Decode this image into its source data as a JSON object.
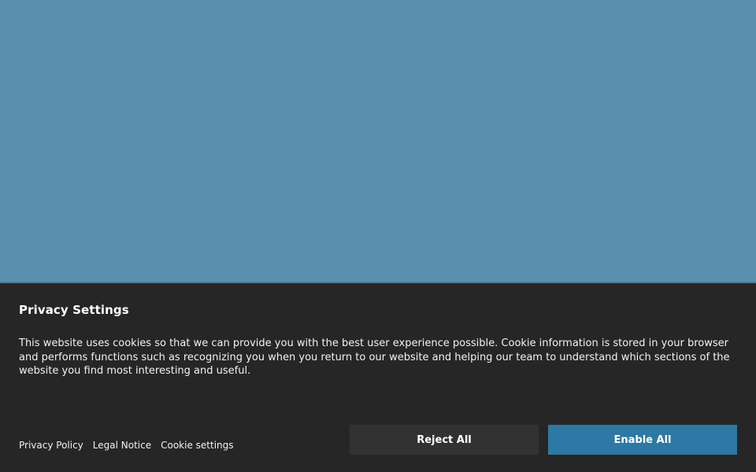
{
  "banner": {
    "title": "Privacy Settings",
    "body": "This website uses cookies so that we can provide you with the best user experience possible.  Cookie information is stored in your browser and performs functions such as recognizing you when you return to our website and helping our team to understand which sections of the website you find most interesting and useful.",
    "links": {
      "privacy_policy": "Privacy Policy",
      "legal_notice": "Legal Notice",
      "cookie_settings": "Cookie settings"
    },
    "buttons": {
      "reject_all": "Reject All",
      "enable_all": "Enable All"
    }
  },
  "colors": {
    "page_background": "#5b8fb0",
    "banner_background": "#272626",
    "reject_button": "#333232",
    "enable_button": "#2d78a4"
  }
}
